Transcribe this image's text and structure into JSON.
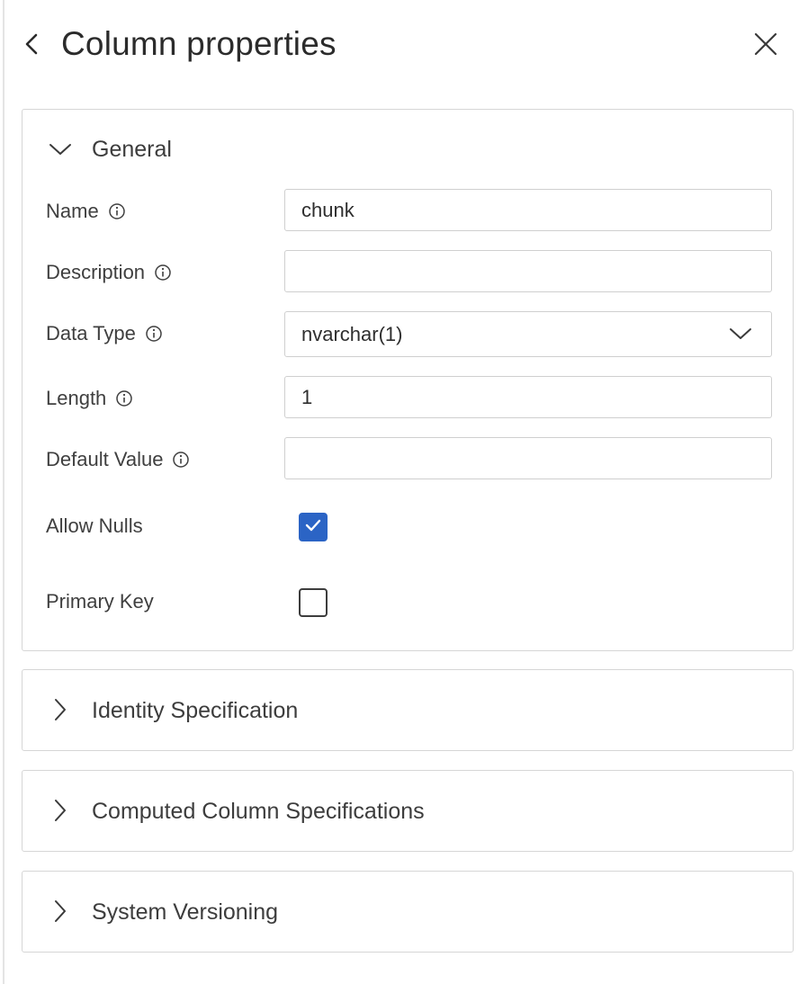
{
  "header": {
    "title": "Column properties",
    "back_icon": "chevron-left-icon",
    "close_icon": "close-icon"
  },
  "general": {
    "title": "General",
    "expanded": true,
    "fields": {
      "name": {
        "label": "Name",
        "value": "chunk"
      },
      "description": {
        "label": "Description",
        "value": ""
      },
      "data_type": {
        "label": "Data Type",
        "value": "nvarchar(1)"
      },
      "length": {
        "label": "Length",
        "value": "1"
      },
      "default_value": {
        "label": "Default Value",
        "value": ""
      },
      "allow_nulls": {
        "label": "Allow Nulls",
        "checked": true
      },
      "primary_key": {
        "label": "Primary Key",
        "checked": false
      }
    }
  },
  "sections": {
    "identity": {
      "title": "Identity Specification",
      "expanded": false
    },
    "computed": {
      "title": "Computed Column Specifications",
      "expanded": false
    },
    "system": {
      "title": "System Versioning",
      "expanded": false
    }
  },
  "colors": {
    "accent": "#2b64c5",
    "border": "#d6d6d6",
    "text": "#3b3b3b"
  }
}
